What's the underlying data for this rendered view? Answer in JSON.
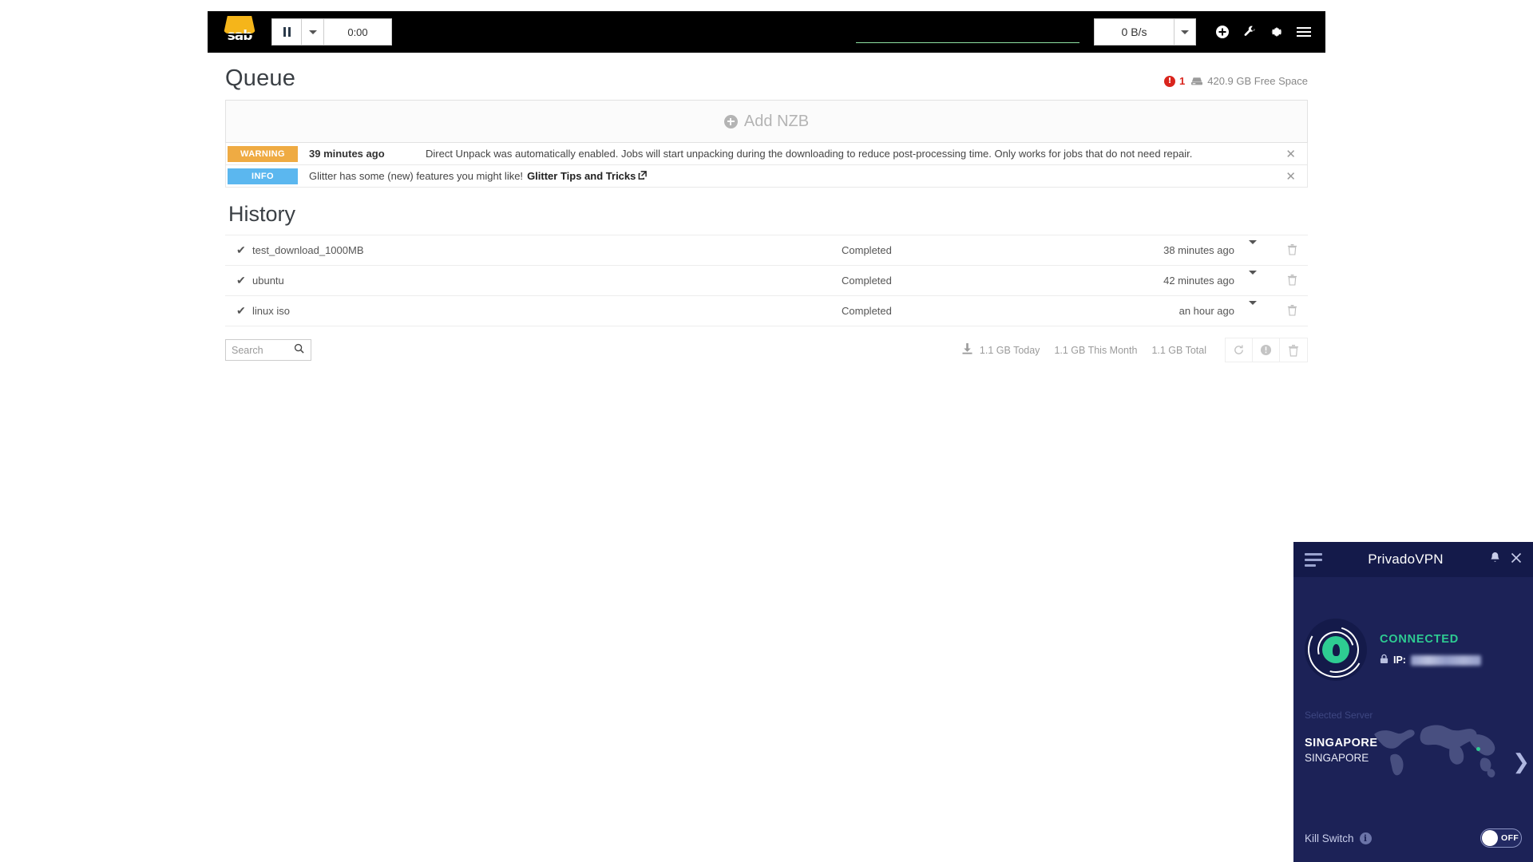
{
  "sabnzbd": {
    "navbar": {
      "logo_text": "sab",
      "pause_icon": "pause-icon",
      "dropdown_icon": "chevron-down-icon",
      "timer": "0:00",
      "speed_limit": "0 B/s",
      "speed_dropdown_icon": "chevron-down-icon",
      "add_icon": "plus-circle-icon",
      "wrench_icon": "wrench-icon",
      "gear_icon": "gear-icon",
      "menu_icon": "hamburger-menu-icon",
      "graph_color": "#8fe3a3"
    },
    "header": {
      "title": "Queue",
      "warning_count": "1",
      "warning_icon": "exclamation-circle-icon",
      "disk_icon": "hard-drive-icon",
      "free_space": "420.9 GB Free Space"
    },
    "add_nzb": {
      "label": "Add NZB",
      "icon": "plus-circle-icon"
    },
    "notices": [
      {
        "tag": "WARNING",
        "tag_color": "#efab43",
        "time": "39 minutes ago",
        "message": "Direct Unpack was automatically enabled. Jobs will start unpacking during the downloading to reduce post-processing time. Only works for jobs that do not need repair.",
        "link_text": "",
        "close_icon": "close-icon"
      },
      {
        "tag": "INFO",
        "tag_color": "#5bb7ef",
        "time": "",
        "message": "Glitter has some (new) features you might like!",
        "link_text": "Glitter Tips and Tricks",
        "close_icon": "close-icon"
      }
    ],
    "history": {
      "title": "History",
      "rows": [
        {
          "check_icon": "checkmark-icon",
          "name": "test_download_1000MB",
          "status": "Completed",
          "time": "38 minutes ago",
          "caret_icon": "chevron-down-icon",
          "trash_icon": "trash-icon"
        },
        {
          "check_icon": "checkmark-icon",
          "name": "ubuntu",
          "status": "Completed",
          "time": "42 minutes ago",
          "caret_icon": "chevron-down-icon",
          "trash_icon": "trash-icon"
        },
        {
          "check_icon": "checkmark-icon",
          "name": "linux iso",
          "status": "Completed",
          "time": "an hour ago",
          "caret_icon": "chevron-down-icon",
          "trash_icon": "trash-icon"
        }
      ],
      "search_placeholder": "Search",
      "search_value": "",
      "search_icon": "search-icon",
      "download_icon": "download-icon",
      "stat_today": "1.1 GB Today",
      "stat_month": "1.1 GB This Month",
      "stat_total": "1.1 GB Total",
      "refresh_icon": "refresh-icon",
      "info_icon": "info-circle-icon",
      "trash_icon": "trash-icon"
    }
  },
  "privadovpn": {
    "menu_icon": "hamburger-menu-icon",
    "title": "PrivadoVPN",
    "bell_icon": "bell-icon",
    "close_icon": "close-icon",
    "shield_icon": "shield-lock-icon",
    "status": "CONNECTED",
    "status_color": "#2ecc92",
    "lock_icon": "lock-icon",
    "ip_label": "IP:",
    "ip_value": "",
    "selected_server_label": "Selected Server",
    "server_name": "SINGAPORE",
    "server_city": "SINGAPORE",
    "next_icon": "chevron-right-icon",
    "kill_switch_label": "Kill Switch",
    "kill_switch_info_icon": "info-icon",
    "kill_switch_state": "OFF"
  }
}
